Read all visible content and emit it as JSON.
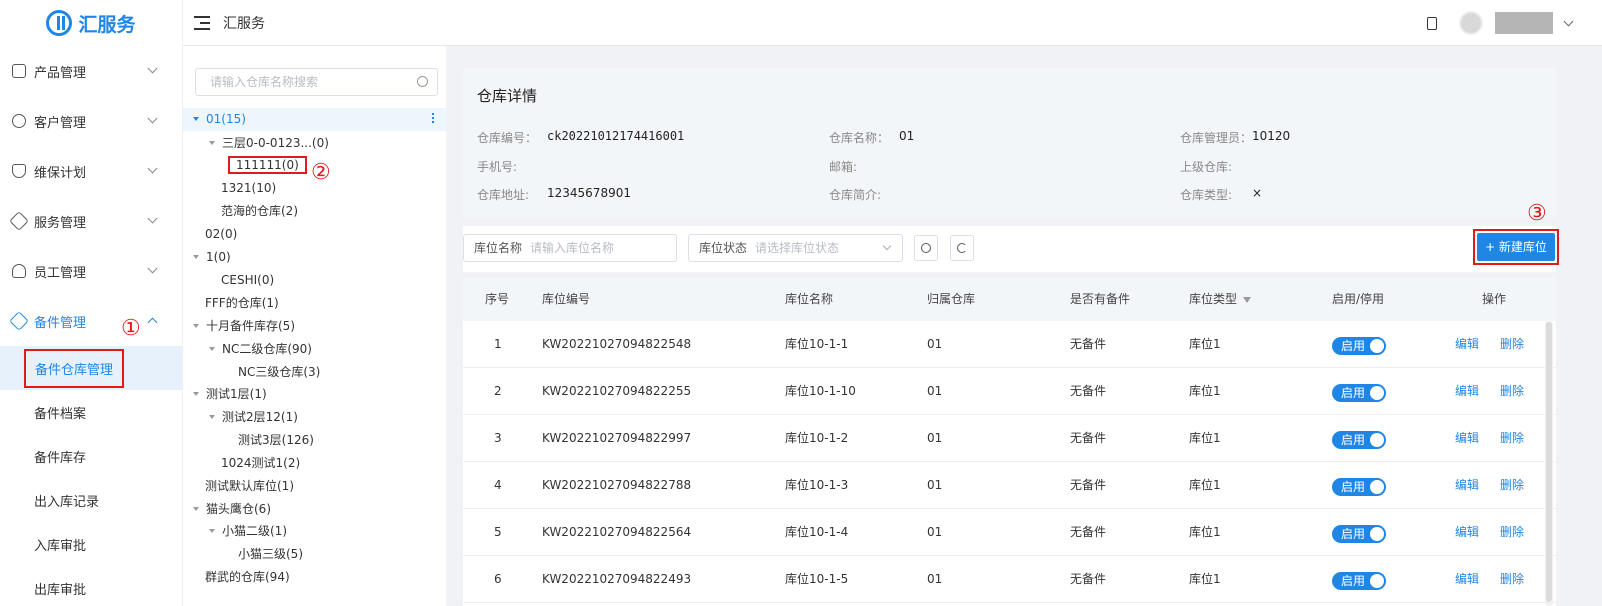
{
  "app": {
    "logo_text": "汇服务",
    "header_title": "汇服务"
  },
  "sidebar": {
    "menu": [
      {
        "label": "产品管理"
      },
      {
        "label": "客户管理"
      },
      {
        "label": "维保计划"
      },
      {
        "label": "服务管理"
      },
      {
        "label": "员工管理"
      },
      {
        "label": "备件管理"
      }
    ],
    "sub_items": [
      {
        "label": "备件仓库管理"
      },
      {
        "label": "备件档案"
      },
      {
        "label": "备件库存"
      },
      {
        "label": "出入库记录"
      },
      {
        "label": "入库审批"
      },
      {
        "label": "出库审批"
      }
    ]
  },
  "annotations": {
    "one": "①",
    "two": "②",
    "three": "③"
  },
  "tree": {
    "search_placeholder": "请输入仓库名称搜索",
    "nodes": [
      {
        "label": "01(15)"
      },
      {
        "label": "三层0-0-0123...(0)"
      },
      {
        "label": "111111(0)"
      },
      {
        "label": "1321(10)"
      },
      {
        "label": "范海的仓库(2)"
      },
      {
        "label": "02(0)"
      },
      {
        "label": "1(0)"
      },
      {
        "label": "CESHI(0)"
      },
      {
        "label": "FFF的仓库(1)"
      },
      {
        "label": "十月备件库存(5)"
      },
      {
        "label": "NC二级仓库(90)"
      },
      {
        "label": "NC三级仓库(3)"
      },
      {
        "label": "测试1层(1)"
      },
      {
        "label": "测试2层12(1)"
      },
      {
        "label": "测试3层(126)"
      },
      {
        "label": "1024测试1(2)"
      },
      {
        "label": "测试默认库位(1)"
      },
      {
        "label": "猫头鹰仓(6)"
      },
      {
        "label": "小猫二级(1)"
      },
      {
        "label": "小猫三级(5)"
      },
      {
        "label": "群武的仓库(94)"
      }
    ]
  },
  "detail": {
    "title": "仓库详情",
    "code_label": "仓库编号：",
    "code_value": "ck20221012174416001",
    "name_label": "仓库名称：",
    "name_value": "01",
    "manager_label": "仓库管理员：",
    "manager_value": "10120",
    "phone_label": "手机号:",
    "email_label": "邮箱:",
    "parent_label": "上级仓库:",
    "address_label": "仓库地址:",
    "address_value": "12345678901",
    "intro_label": "仓库简介:",
    "type_label": "仓库类型:",
    "type_value": "×"
  },
  "filters": {
    "name_label": "库位名称",
    "name_placeholder": "请输入库位名称",
    "status_label": "库位状态",
    "status_placeholder": "请选择库位状态",
    "new_button": "+ 新建库位"
  },
  "table": {
    "headers": [
      "序号",
      "库位编号",
      "库位名称",
      "归属仓库",
      "是否有备件",
      "库位类型",
      "启用/停用",
      "操作"
    ],
    "toggle_label": "启用",
    "edit_label": "编辑",
    "delete_label": "删除",
    "rows": [
      {
        "no": "1",
        "code": "KW20221027094822548",
        "name": "库位10-1-1",
        "warehouse": "01",
        "has_parts": "无备件",
        "type": "库位1"
      },
      {
        "no": "2",
        "code": "KW20221027094822255",
        "name": "库位10-1-10",
        "warehouse": "01",
        "has_parts": "无备件",
        "type": "库位1"
      },
      {
        "no": "3",
        "code": "KW20221027094822997",
        "name": "库位10-1-2",
        "warehouse": "01",
        "has_parts": "无备件",
        "type": "库位1"
      },
      {
        "no": "4",
        "code": "KW20221027094822788",
        "name": "库位10-1-3",
        "warehouse": "01",
        "has_parts": "无备件",
        "type": "库位1"
      },
      {
        "no": "5",
        "code": "KW20221027094822564",
        "name": "库位10-1-4",
        "warehouse": "01",
        "has_parts": "无备件",
        "type": "库位1"
      },
      {
        "no": "6",
        "code": "KW20221027094822493",
        "name": "库位10-1-5",
        "warehouse": "01",
        "has_parts": "无备件",
        "type": "库位1"
      }
    ]
  }
}
